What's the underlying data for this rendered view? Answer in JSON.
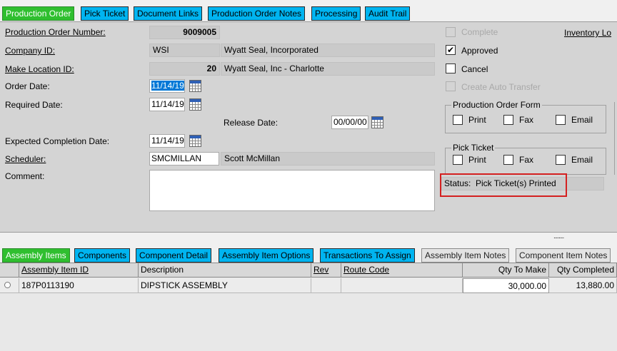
{
  "top_tabs": [
    {
      "label": "Production Order"
    },
    {
      "label": "Pick Ticket"
    },
    {
      "label": "Document Links"
    },
    {
      "label": "Production Order Notes"
    },
    {
      "label": "Processing"
    },
    {
      "label": "Audit Trail"
    }
  ],
  "form": {
    "order_number_label": "Production Order Number:",
    "order_number": "9009005",
    "company_id_label": "Company ID:",
    "company_id": "WSI",
    "company_name": "Wyatt Seal, Incorporated",
    "make_location_label": "Make Location ID:",
    "make_location_id": "20",
    "make_location_name": "Wyatt Seal, Inc - Charlotte",
    "order_date_label": "Order Date:",
    "order_date": "11/14/19",
    "required_date_label": "Required Date:",
    "required_date": "11/14/19",
    "release_date_label": "Release Date:",
    "release_date": "00/00/00",
    "expected_completion_label": "Expected Completion Date:",
    "expected_completion_date": "11/14/19",
    "scheduler_label": "Scheduler:",
    "scheduler_id": "SMCMILLAN",
    "scheduler_name": "Scott McMillan",
    "comment_label": "Comment:",
    "comment": ""
  },
  "options": {
    "complete_label": "Complete",
    "approved_label": "Approved",
    "cancel_label": "Cancel",
    "create_auto_transfer_label": "Create Auto Transfer",
    "inventory_link_label": "Inventory Lo",
    "approved_checked": true,
    "checkmark": "✔"
  },
  "production_order_form": {
    "title": "Production Order Form",
    "print_label": "Print",
    "fax_label": "Fax",
    "email_label": "Email"
  },
  "pick_ticket": {
    "title": "Pick Ticket",
    "print_label": "Print",
    "fax_label": "Fax",
    "email_label": "Email"
  },
  "status": {
    "label": "Status:",
    "value": "Pick Ticket(s) Printed"
  },
  "splitter_grip": "........",
  "bottom_tabs": [
    {
      "label": "Assembly Items"
    },
    {
      "label": "Components"
    },
    {
      "label": "Component Detail"
    },
    {
      "label": "Assembly Item Options"
    },
    {
      "label": "Transactions To Assign"
    },
    {
      "label": "Assembly Item Notes"
    },
    {
      "label": "Component Item Notes"
    }
  ],
  "grid": {
    "columns": [
      "Assembly Item ID",
      "Description",
      "Rev",
      "Route Code",
      "Qty To Make",
      "Qty Completed"
    ],
    "rows": [
      {
        "assembly_item_id": "187P0113190",
        "description": "DIPSTICK ASSEMBLY",
        "rev": "",
        "route_code": "",
        "qty_to_make": "30,000.00",
        "qty_completed": "13,880.00"
      }
    ]
  },
  "colors": {
    "active_tab": "#2fbf2f",
    "tab": "#00b4f0",
    "status_highlight": "#d42020",
    "selection": "#0078d7"
  }
}
